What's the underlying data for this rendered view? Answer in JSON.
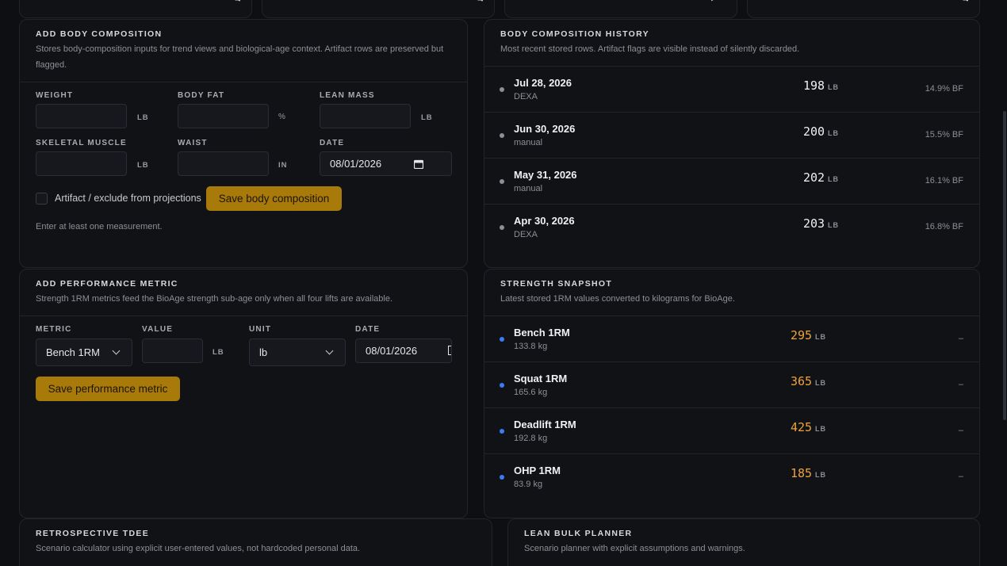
{
  "top_cards": [
    {
      "name": "metric-card-1"
    },
    {
      "name": "metric-card-2"
    },
    {
      "name": "metric-card-3"
    },
    {
      "name": "metric-card-4"
    }
  ],
  "add_body": {
    "title": "ADD BODY COMPOSITION",
    "subtitle": "Stores body-composition inputs for trend views and biological-age context. Artifact rows are preserved but flagged.",
    "fields": {
      "weight": {
        "label": "WEIGHT",
        "unit": "LB",
        "value": ""
      },
      "body_fat": {
        "label": "BODY FAT",
        "unit": "%",
        "value": ""
      },
      "lean_mass": {
        "label": "LEAN MASS",
        "unit": "LB",
        "value": ""
      },
      "skeletal_muscle": {
        "label": "SKELETAL MUSCLE",
        "unit": "LB",
        "value": ""
      },
      "waist": {
        "label": "WAIST",
        "unit": "IN",
        "value": ""
      },
      "date": {
        "label": "DATE",
        "value": "08/01/2026"
      }
    },
    "artifact_label": "Artifact / exclude from projections",
    "save_label": "Save body composition",
    "hint": "Enter at least one measurement."
  },
  "history": {
    "title": "BODY COMPOSITION HISTORY",
    "subtitle": "Most recent stored rows. Artifact flags are visible instead of silently discarded.",
    "rows": [
      {
        "date": "Jul 28, 2026",
        "source": "DEXA",
        "weight": "198",
        "unit": "LB",
        "bf": "14.9% BF"
      },
      {
        "date": "Jun 30, 2026",
        "source": "manual",
        "weight": "200",
        "unit": "LB",
        "bf": "15.5% BF"
      },
      {
        "date": "May 31, 2026",
        "source": "manual",
        "weight": "202",
        "unit": "LB",
        "bf": "16.1% BF"
      },
      {
        "date": "Apr 30, 2026",
        "source": "DEXA",
        "weight": "203",
        "unit": "LB",
        "bf": "16.8% BF"
      }
    ]
  },
  "add_perf": {
    "title": "ADD PERFORMANCE METRIC",
    "subtitle": "Strength 1RM metrics feed the BioAge strength sub-age only when all four lifts are available.",
    "metric_label": "METRIC",
    "metric_value": "Bench 1RM",
    "value_label": "VALUE",
    "value_unit": "LB",
    "unit_label": "UNIT",
    "unit_value": "lb",
    "date_label": "DATE",
    "date_value": "08/01/2026",
    "save_label": "Save performance metric"
  },
  "strength": {
    "title": "STRENGTH SNAPSHOT",
    "subtitle": "Latest stored 1RM values converted to kilograms for BioAge.",
    "rows": [
      {
        "name": "Bench 1RM",
        "kg": "133.8 kg",
        "value": "295",
        "unit": "LB",
        "right": "–"
      },
      {
        "name": "Squat 1RM",
        "kg": "165.6 kg",
        "value": "365",
        "unit": "LB",
        "right": "–"
      },
      {
        "name": "Deadlift 1RM",
        "kg": "192.8 kg",
        "value": "425",
        "unit": "LB",
        "right": "–"
      },
      {
        "name": "OHP 1RM",
        "kg": "83.9 kg",
        "value": "185",
        "unit": "LB",
        "right": "–"
      }
    ]
  },
  "tdee": {
    "title": "RETROSPECTIVE TDEE",
    "subtitle": "Scenario calculator using explicit user-entered values, not hardcoded personal data."
  },
  "bulk": {
    "title": "LEAN BULK PLANNER",
    "subtitle": "Scenario planner with explicit assumptions and warnings."
  },
  "colors": {
    "accent": "#a87a0a",
    "strength_value": "#f0a23a",
    "strength_dot": "#3b7cf5",
    "history_dot": "#8d8f96"
  }
}
